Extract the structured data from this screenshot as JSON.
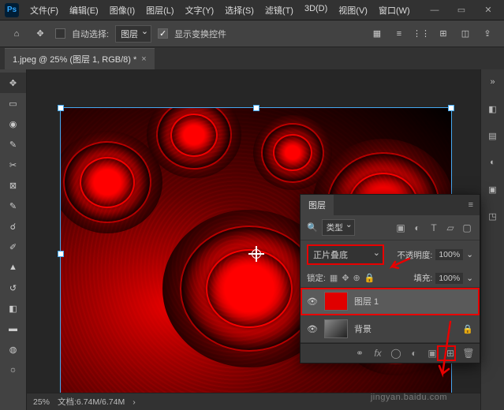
{
  "app": {
    "name": "Ps"
  },
  "menu": [
    "文件(F)",
    "编辑(E)",
    "图像(I)",
    "图层(L)",
    "文字(Y)",
    "选择(S)",
    "滤镜(T)",
    "3D(D)",
    "视图(V)",
    "窗口(W)"
  ],
  "options": {
    "auto_select_label": "自动选择:",
    "auto_select_target": "图层",
    "show_transform_label": "显示变换控件"
  },
  "document": {
    "tab_title": "1.jpeg @ 25% (图层 1, RGB/8) *",
    "zoom": "25%",
    "filesize": "文档:6.74M/6.74M"
  },
  "layers_panel": {
    "title": "图层",
    "filter_label": "类型",
    "blend_mode": "正片叠底",
    "opacity_label": "不透明度:",
    "opacity_value": "100%",
    "lock_label": "锁定:",
    "fill_label": "填充:",
    "fill_value": "100%",
    "layers": [
      {
        "name": "图层 1",
        "thumb": "red",
        "selected": true,
        "locked": false
      },
      {
        "name": "背景",
        "thumb": "bg",
        "selected": false,
        "locked": true
      }
    ]
  },
  "watermark": "jingyan.baidu.com",
  "colors": {
    "accent_red": "#e80000",
    "ps_blue": "#31a8ff"
  }
}
